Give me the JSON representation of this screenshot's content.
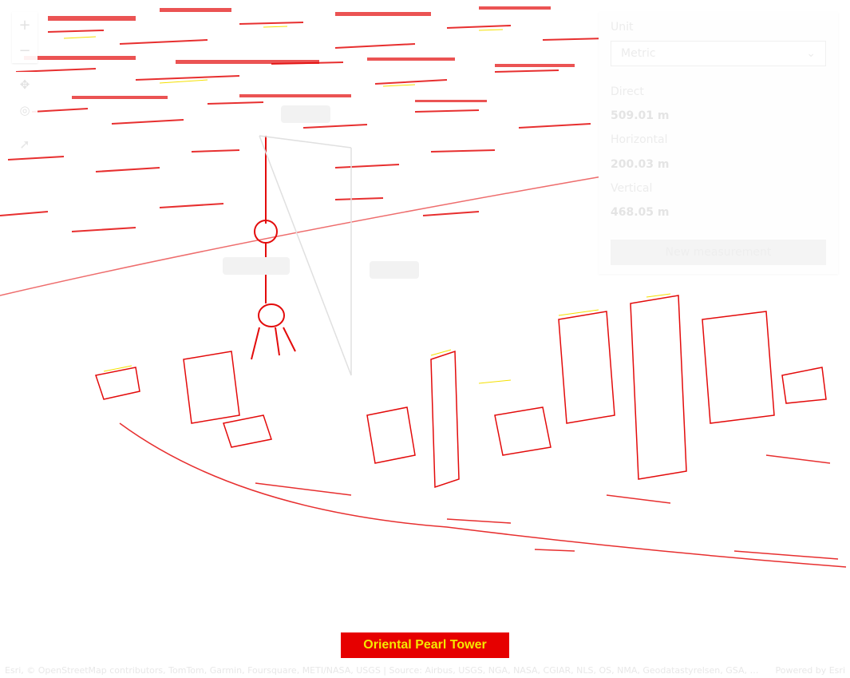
{
  "zoom": {
    "in_label": "+",
    "out_label": "−"
  },
  "nav": {
    "pan_icon": "move-icon",
    "rotate_icon": "compass-icon"
  },
  "measure_tool": {
    "icon": "pointer-icon"
  },
  "panel": {
    "unit_label": "Unit",
    "unit_value": "Metric",
    "direct_label": "Direct",
    "direct_value": "509.01 m",
    "horizontal_label": "Horizontal",
    "horizontal_value": "200.03 m",
    "vertical_label": "Vertical",
    "vertical_value": "468.05 m",
    "new_button": "New measurement"
  },
  "banner": {
    "text": "Oriental Pearl Tower"
  },
  "attribution": {
    "text": "Esri, © OpenStreetMap contributors, TomTom, Garmin, Foursquare, METI/NASA, USGS | Source: Airbus, USGS, NGA, NASA, CGIAR, NLS, OS, NMA, Geodatastyrelsen, GSA, GSI and...",
    "powered": "Powered by Esri"
  },
  "colors": {
    "accent": "#e60000",
    "highlight": "#f4e800"
  }
}
